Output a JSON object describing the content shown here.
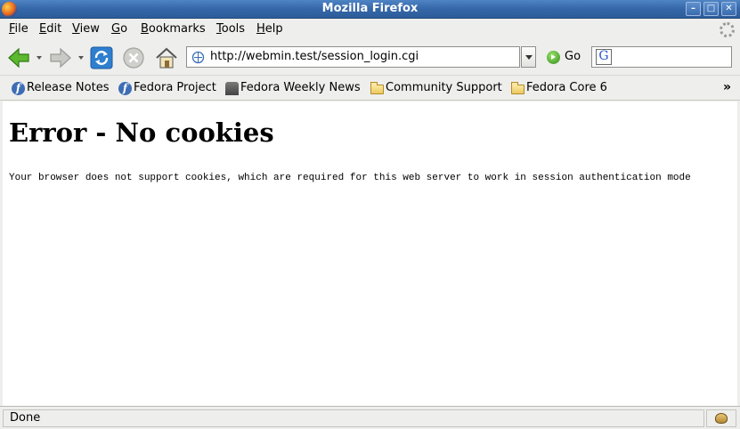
{
  "window": {
    "title": "Mozilla Firefox"
  },
  "menu": {
    "file": {
      "key": "F",
      "rest": "ile"
    },
    "edit": {
      "key": "E",
      "rest": "dit"
    },
    "view": {
      "key": "V",
      "rest": "iew"
    },
    "go": {
      "key": "G",
      "rest": "o"
    },
    "bookmarks": {
      "key": "B",
      "rest": "ookmarks"
    },
    "tools": {
      "key": "T",
      "rest": "ools"
    },
    "help": {
      "key": "H",
      "rest": "elp"
    }
  },
  "navigation": {
    "url": "http://webmin.test/session_login.cgi",
    "go_label": "Go",
    "search_value": "",
    "search_engine_letter": "G"
  },
  "bookmarks": [
    {
      "label": "Release Notes",
      "icon": "fedora-icon"
    },
    {
      "label": "Fedora Project",
      "icon": "fedora-icon"
    },
    {
      "label": "Fedora Weekly News",
      "icon": "people-icon"
    },
    {
      "label": "Community Support",
      "icon": "folder-icon"
    },
    {
      "label": "Fedora Core 6",
      "icon": "folder-icon"
    }
  ],
  "bookmarks_overflow": "»",
  "page": {
    "heading": "Error - No cookies",
    "message": "Your browser does not support cookies, which are required for this web server to work in session authentication mode"
  },
  "status": {
    "text": "Done"
  },
  "colors": {
    "titlebar": "#3567a8",
    "chrome": "#eeeeec",
    "content_bg": "#ffffff"
  }
}
